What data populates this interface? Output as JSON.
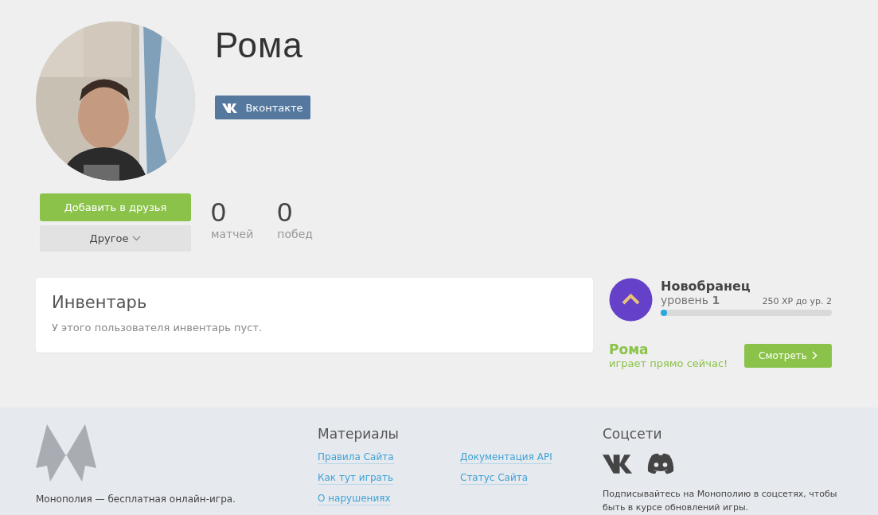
{
  "profile": {
    "name": "Рома",
    "social_button": "Вконтакте",
    "add_friend_button": "Добавить в друзья",
    "other_button": "Другое",
    "stats": [
      {
        "value": "0",
        "label": "матчей"
      },
      {
        "value": "0",
        "label": "побед"
      }
    ]
  },
  "inventory": {
    "title": "Инвентарь",
    "message": "У этого пользователя инвентарь пуст."
  },
  "level": {
    "rank": "Новобранец",
    "level_label": "уровень **1**",
    "xp_left": "250 XP до ур. 2",
    "level": 0.02
  },
  "now_playing": {
    "name": "Рома",
    "status": "играет прямо сейчас!",
    "button": "Смотреть"
  },
  "footer": {
    "about": "Монополия — бесплатная онлайн-игра.",
    "materials": {
      "title": "Материалы",
      "links": [
        "Правила Сайта",
        "Как тут играть",
        "О нарушениях",
        "Документация API",
        "Статус Сайта"
      ]
    },
    "social": {
      "title": "Соцсети",
      "text": "Подписывайтесь на Монополию в соцсетях, чтобы быть в курсе обновлений игры."
    }
  }
}
